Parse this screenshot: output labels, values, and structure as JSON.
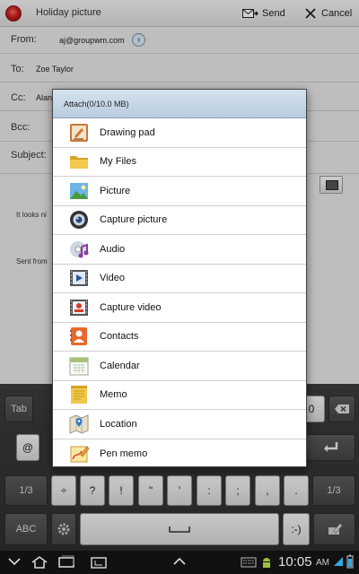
{
  "compose": {
    "title": "Holiday picture",
    "send_label": "Send",
    "cancel_label": "Cancel",
    "from_label": "From:",
    "from_value": "aj@groupwm.com",
    "to_label": "To:",
    "to_value": "Zoe Taylor",
    "cc_label": "Cc:",
    "cc_value": "Alan",
    "bcc_label": "Bcc:",
    "subject_label": "Subject:",
    "body_line1": "It looks ni",
    "body_line2": "Sent from"
  },
  "dialog": {
    "title": "Attach(0/10.0 MB)",
    "items": [
      {
        "label": "Drawing pad",
        "icon": "drawing-pad-icon"
      },
      {
        "label": "My Files",
        "icon": "folder-icon"
      },
      {
        "label": "Picture",
        "icon": "picture-icon"
      },
      {
        "label": "Capture picture",
        "icon": "camera-icon"
      },
      {
        "label": "Audio",
        "icon": "audio-icon"
      },
      {
        "label": "Video",
        "icon": "video-icon"
      },
      {
        "label": "Capture video",
        "icon": "capture-video-icon"
      },
      {
        "label": "Contacts",
        "icon": "contacts-icon"
      },
      {
        "label": "Calendar",
        "icon": "calendar-icon"
      },
      {
        "label": "Memo",
        "icon": "memo-icon"
      },
      {
        "label": "Location",
        "icon": "location-icon"
      },
      {
        "label": "Pen memo",
        "icon": "pen-memo-icon"
      }
    ]
  },
  "keyboard": {
    "tab": "Tab",
    "zero": "0",
    "at": "@",
    "row3": [
      "1/3",
      "÷",
      "?",
      "!",
      "\"",
      "'",
      ":",
      ";",
      ",",
      ".",
      "1/3"
    ],
    "abc": "ABC",
    "emoticon": ":-)"
  },
  "status": {
    "time": "10:05",
    "ampm": "AM"
  },
  "colors": {
    "dialog_header": "#c4d6e8",
    "keyboard_bg": "#333333"
  }
}
